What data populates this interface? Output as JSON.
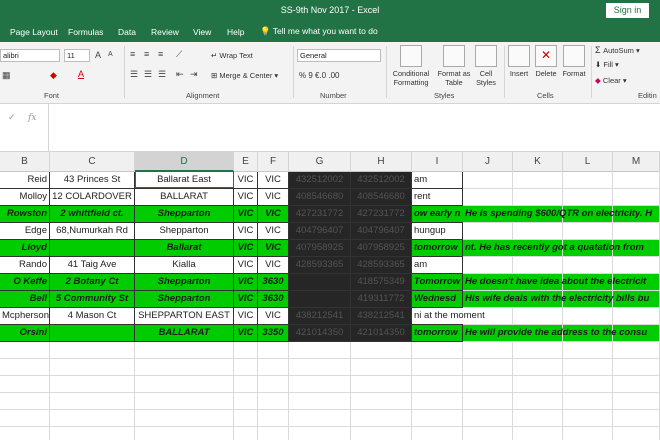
{
  "window": {
    "title": "SS-9th Nov 2017  -  Excel",
    "signin": "Sign in"
  },
  "tabs": [
    "Page Layout",
    "Formulas",
    "Data",
    "Review",
    "View",
    "Help"
  ],
  "tellme": "Tell me what you want to do",
  "ribbon": {
    "font_name": "alibri",
    "font_size": "11",
    "wrap_text": "Wrap Text",
    "merge_center": "Merge & Center",
    "number_format": "General",
    "number_glyphs": "% 9 €.0 .00",
    "cond_fmt": "Conditional Formatting",
    "format_table": "Format as Table",
    "cell_styles": "Cell Styles",
    "insert": "Insert",
    "delete": "Delete",
    "format": "Format",
    "autosum": "AutoSum",
    "fill": "Fill",
    "clear": "Clear",
    "groups": {
      "font": "Font",
      "alignment": "Alignment",
      "number": "Number",
      "styles": "Styles",
      "cells": "Cells",
      "editing": "Editin"
    }
  },
  "formula_bar": {
    "cancel": "✓",
    "fx": "fx",
    "value": ""
  },
  "columns": [
    "B",
    "C",
    "D",
    "E",
    "F",
    "G",
    "H",
    "I",
    "J",
    "K",
    "L",
    "M"
  ],
  "rows": [
    {
      "style": "plain",
      "cells": [
        "Reid",
        "43 Princes St",
        "Ballarat East",
        "VIC",
        "VIC",
        "432512002",
        "432512002",
        "am",
        "",
        "",
        "",
        ""
      ]
    },
    {
      "style": "plain",
      "cells": [
        "Molloy",
        "12 COLARDOVER",
        "BALLARAT",
        "VIC",
        "VIC",
        "408546680",
        "408546680",
        "rent",
        "",
        "",
        "",
        ""
      ]
    },
    {
      "style": "green",
      "cells": [
        "Rowston",
        "2 whittfield ct.",
        "Shepparton",
        "VIC",
        "VIC",
        "427231772",
        "427231772",
        "ow early n",
        "He is spending $600/QTR on electricity. H",
        "",
        "",
        ""
      ]
    },
    {
      "style": "plain",
      "cells": [
        "Edge",
        "68,Numurkah Rd",
        "Shepparton",
        "VIC",
        "VIC",
        "404796407",
        "404796407",
        "hungup",
        "",
        "",
        "",
        ""
      ]
    },
    {
      "style": "green",
      "cells": [
        "Lloyd",
        "",
        "Ballarat",
        "VIC",
        "VIC",
        "407958925",
        "407958925",
        "tomorrow",
        "nt. He has recently got a quatation from",
        "",
        "",
        ""
      ]
    },
    {
      "style": "plain",
      "cells": [
        "Rando",
        "41 Taig Ave",
        "Kialla",
        "VIC",
        "VIC",
        "428593365",
        "428593365",
        "am",
        "",
        "",
        "",
        ""
      ]
    },
    {
      "style": "green",
      "cells": [
        "O Keffe",
        "2 Botany Ct",
        "Shepparton",
        "VIC",
        "3630",
        "",
        "418575349",
        "Tomorrow",
        "He doesn't have idea about the electricit",
        "",
        "",
        ""
      ]
    },
    {
      "style": "green",
      "cells": [
        "Bell",
        "5 Community St",
        "Shepparton",
        "VIC",
        "3630",
        "",
        "419311772",
        "Wednesd",
        "His wife deals with the electricity bills bu",
        "",
        "",
        ""
      ]
    },
    {
      "style": "plain",
      "cells": [
        "Mcpherson",
        "4 Mason Ct",
        "SHEPPARTON EAST",
        "VIC",
        "VIC",
        "438212541",
        "438212541",
        "ni at the moment",
        "",
        "",
        "",
        ""
      ]
    },
    {
      "style": "green",
      "cells": [
        "Orsini",
        "",
        "BALLARAT",
        "VIC",
        "3350",
        "421014350",
        "421014350",
        "tomorrow",
        "He will provide the address to the consu",
        "",
        "",
        ""
      ]
    }
  ]
}
